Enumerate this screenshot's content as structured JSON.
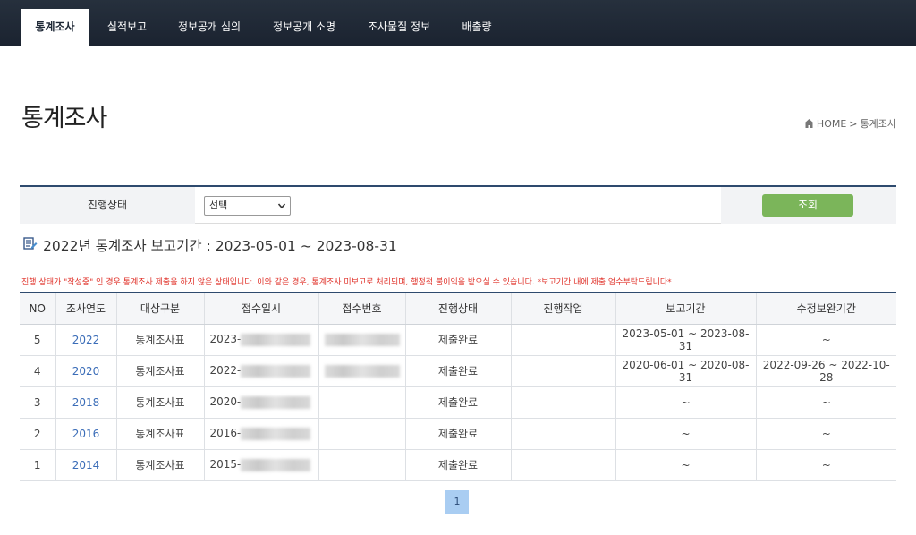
{
  "nav": {
    "tabs": [
      {
        "label": "통계조사"
      },
      {
        "label": "실적보고"
      },
      {
        "label": "정보공개 심의"
      },
      {
        "label": "정보공개 소명"
      },
      {
        "label": "조사물질 정보"
      },
      {
        "label": "배출량"
      }
    ]
  },
  "page": {
    "title": "통계조사",
    "breadcrumb_home": "HOME",
    "breadcrumb_sep": ">",
    "breadcrumb_current": "통계조사"
  },
  "search": {
    "label": "진행상태",
    "select_value": "선택",
    "button_label": "조회"
  },
  "period": {
    "text": "2022년 통계조사 보고기간 : 2023-05-01 ~ 2023-08-31"
  },
  "notice": "진행 상태가 \"작성중\" 인 경우 통계조사 제출을 하지 않은 상태입니다. 이와 같은 경우, 통계조사 미보고로 처리되며, 행정적 불이익을 받으실 수 있습니다. *보고기간 내에 제출 엄수부탁드립니다*",
  "table": {
    "headers": [
      "NO",
      "조사연도",
      "대상구분",
      "접수일시",
      "접수번호",
      "진행상태",
      "진행작업",
      "보고기간",
      "수정보완기간"
    ],
    "rows": [
      {
        "no": "5",
        "year": "2022",
        "type": "통계조사표",
        "date_prefix": "2023-",
        "status": "제출완료",
        "action": "",
        "period": "2023-05-01 ~ 2023-08-31",
        "fix_period": "~"
      },
      {
        "no": "4",
        "year": "2020",
        "type": "통계조사표",
        "date_prefix": "2022-",
        "status": "제출완료",
        "action": "",
        "period": "2020-06-01 ~ 2020-08-31",
        "fix_period": "2022-09-26 ~ 2022-10-28"
      },
      {
        "no": "3",
        "year": "2018",
        "type": "통계조사표",
        "date_prefix": "2020-",
        "status": "제출완료",
        "action": "",
        "period": "~",
        "fix_period": "~"
      },
      {
        "no": "2",
        "year": "2016",
        "type": "통계조사표",
        "date_prefix": "2016-",
        "status": "제출완료",
        "action": "",
        "period": "~",
        "fix_period": "~"
      },
      {
        "no": "1",
        "year": "2014",
        "type": "통계조사표",
        "date_prefix": "2015-",
        "status": "제출완료",
        "action": "",
        "period": "~",
        "fix_period": "~"
      }
    ]
  },
  "pagination": {
    "current": "1"
  },
  "colors": {
    "nav_bg": "#1e2836",
    "accent_line": "#2e4a6e",
    "button_green": "#7bb55a",
    "link_blue": "#3b6db8",
    "notice_red": "#e0322a",
    "pager_bg": "#a9cdf2"
  }
}
